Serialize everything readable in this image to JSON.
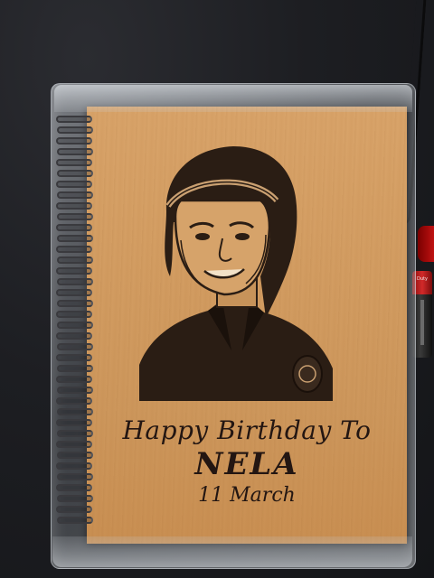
{
  "cover": {
    "greeting": "Happy Birthday To",
    "name": "NELA",
    "date": "11 March"
  },
  "battery": {
    "label": "Duty"
  },
  "colors": {
    "wood": "#d29c61",
    "ink": "#231612",
    "background": "#1b1c20",
    "battery_red": "#c71313"
  }
}
